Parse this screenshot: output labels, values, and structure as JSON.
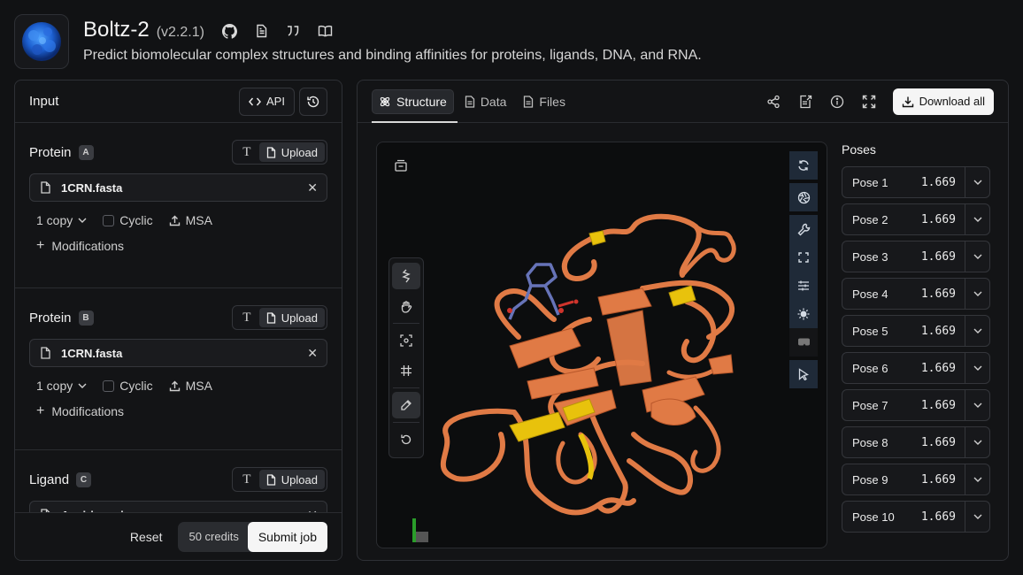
{
  "app": {
    "name": "Boltz-2",
    "version": "(v2.2.1)",
    "description": "Predict biomolecular complex structures and binding affinities for proteins, ligands, DNA, and RNA.",
    "header_icons": [
      "github-icon",
      "document-icon",
      "quote-icon",
      "book-icon"
    ]
  },
  "input_panel": {
    "title": "Input",
    "api_label": "API",
    "sections": [
      {
        "label": "Protein",
        "chip": "A",
        "upload_label": "Upload",
        "file": "1CRN.fasta",
        "copies": "1 copy",
        "cyclic_label": "Cyclic",
        "msa_label": "MSA",
        "modifications_label": "Modifications"
      },
      {
        "label": "Protein",
        "chip": "B",
        "upload_label": "Upload",
        "file": "1CRN.fasta",
        "copies": "1 copy",
        "cyclic_label": "Cyclic",
        "msa_label": "MSA",
        "modifications_label": "Modifications"
      },
      {
        "label": "Ligand",
        "chip": "C",
        "upload_label": "Upload",
        "file": "Aspirin.smi"
      }
    ],
    "footer": {
      "reset_label": "Reset",
      "credits_label": "50 credits",
      "submit_label": "Submit job"
    }
  },
  "output_panel": {
    "tabs": [
      {
        "label": "Structure",
        "icon": "atom-icon",
        "active": true
      },
      {
        "label": "Data",
        "icon": "document-icon",
        "active": false
      },
      {
        "label": "Files",
        "icon": "file-icon",
        "active": false
      }
    ],
    "actions": [
      "share-icon",
      "export-icon",
      "info-icon",
      "fullscreen-icon"
    ],
    "download_label": "Download all",
    "poses_title": "Poses",
    "poses": [
      {
        "label": "Pose 1",
        "score": "1.669"
      },
      {
        "label": "Pose 2",
        "score": "1.669"
      },
      {
        "label": "Pose 3",
        "score": "1.669"
      },
      {
        "label": "Pose 4",
        "score": "1.669"
      },
      {
        "label": "Pose 5",
        "score": "1.669"
      },
      {
        "label": "Pose 6",
        "score": "1.669"
      },
      {
        "label": "Pose 7",
        "score": "1.669"
      },
      {
        "label": "Pose 8",
        "score": "1.669"
      },
      {
        "label": "Pose 9",
        "score": "1.669"
      },
      {
        "label": "Pose 10",
        "score": "1.669"
      }
    ]
  },
  "colors": {
    "background": "#111214",
    "ribbon": "#e07a45",
    "ribbon_highlight": "#e8c20c",
    "ligand": "#6673b8",
    "toolbar_blue": "#1f2a38"
  }
}
